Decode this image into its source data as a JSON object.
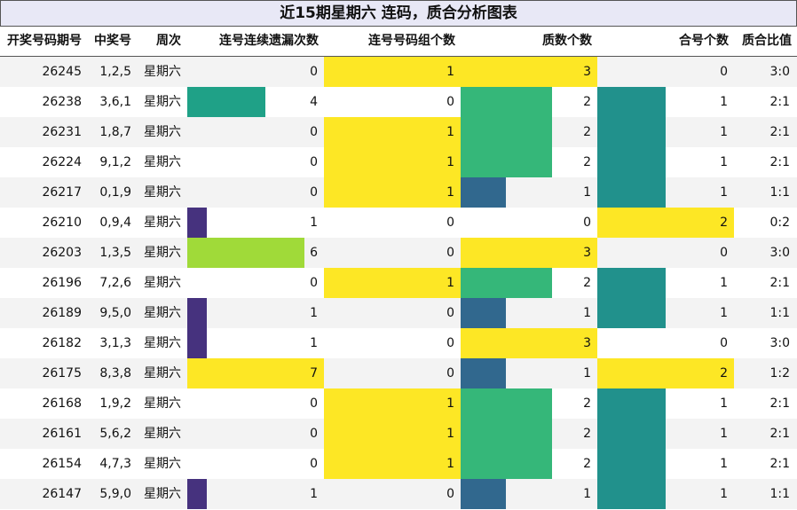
{
  "title": "近15期星期六 连码，质合分析图表",
  "headers": {
    "issue": "开奖号码期号",
    "numbers": "中奖号",
    "weekday": "周次",
    "consec_miss": "连号连续遗漏次数",
    "consec_groups": "连号号码组个数",
    "prime_count": "质数个数",
    "composite_count": "合号个数",
    "ratio": "质合比值"
  },
  "colors": {
    "v0": "#ffffff",
    "v1_purple": "#46327e",
    "v1_blue": "#31688e",
    "v2_teal": "#21918c",
    "v2_green": "#35b779",
    "v3_yellow": "#fde725",
    "v4_teal": "#1fa187",
    "v6_lime": "#a0da39",
    "v7_yellow": "#fde725"
  },
  "chart_data": {
    "type": "table",
    "columns": [
      "开奖号码期号",
      "中奖号",
      "周次",
      "连号连续遗漏次数",
      "连号号码组个数",
      "质数个数",
      "合号个数",
      "质合比值"
    ],
    "rows": [
      {
        "issue": "26245",
        "numbers": "1,2,5",
        "weekday": "星期六",
        "consec_miss": 0,
        "consec_groups": 1,
        "prime_count": 3,
        "composite_count": 0,
        "ratio": "3:0"
      },
      {
        "issue": "26238",
        "numbers": "3,6,1",
        "weekday": "星期六",
        "consec_miss": 4,
        "consec_groups": 0,
        "prime_count": 2,
        "composite_count": 1,
        "ratio": "2:1"
      },
      {
        "issue": "26231",
        "numbers": "1,8,7",
        "weekday": "星期六",
        "consec_miss": 0,
        "consec_groups": 1,
        "prime_count": 2,
        "composite_count": 1,
        "ratio": "2:1"
      },
      {
        "issue": "26224",
        "numbers": "9,1,2",
        "weekday": "星期六",
        "consec_miss": 0,
        "consec_groups": 1,
        "prime_count": 2,
        "composite_count": 1,
        "ratio": "2:1"
      },
      {
        "issue": "26217",
        "numbers": "0,1,9",
        "weekday": "星期六",
        "consec_miss": 0,
        "consec_groups": 1,
        "prime_count": 1,
        "composite_count": 1,
        "ratio": "1:1"
      },
      {
        "issue": "26210",
        "numbers": "0,9,4",
        "weekday": "星期六",
        "consec_miss": 1,
        "consec_groups": 0,
        "prime_count": 0,
        "composite_count": 2,
        "ratio": "0:2"
      },
      {
        "issue": "26203",
        "numbers": "1,3,5",
        "weekday": "星期六",
        "consec_miss": 6,
        "consec_groups": 0,
        "prime_count": 3,
        "composite_count": 0,
        "ratio": "3:0"
      },
      {
        "issue": "26196",
        "numbers": "7,2,6",
        "weekday": "星期六",
        "consec_miss": 0,
        "consec_groups": 1,
        "prime_count": 2,
        "composite_count": 1,
        "ratio": "2:1"
      },
      {
        "issue": "26189",
        "numbers": "9,5,0",
        "weekday": "星期六",
        "consec_miss": 1,
        "consec_groups": 0,
        "prime_count": 1,
        "composite_count": 1,
        "ratio": "1:1"
      },
      {
        "issue": "26182",
        "numbers": "3,1,3",
        "weekday": "星期六",
        "consec_miss": 1,
        "consec_groups": 0,
        "prime_count": 3,
        "composite_count": 0,
        "ratio": "3:0"
      },
      {
        "issue": "26175",
        "numbers": "8,3,8",
        "weekday": "星期六",
        "consec_miss": 7,
        "consec_groups": 0,
        "prime_count": 1,
        "composite_count": 2,
        "ratio": "1:2"
      },
      {
        "issue": "26168",
        "numbers": "1,9,2",
        "weekday": "星期六",
        "consec_miss": 0,
        "consec_groups": 1,
        "prime_count": 2,
        "composite_count": 1,
        "ratio": "2:1"
      },
      {
        "issue": "26161",
        "numbers": "5,6,2",
        "weekday": "星期六",
        "consec_miss": 0,
        "consec_groups": 1,
        "prime_count": 2,
        "composite_count": 1,
        "ratio": "2:1"
      },
      {
        "issue": "26154",
        "numbers": "4,7,3",
        "weekday": "星期六",
        "consec_miss": 0,
        "consec_groups": 1,
        "prime_count": 2,
        "composite_count": 1,
        "ratio": "2:1"
      },
      {
        "issue": "26147",
        "numbers": "5,9,0",
        "weekday": "星期六",
        "consec_miss": 1,
        "consec_groups": 0,
        "prime_count": 1,
        "composite_count": 1,
        "ratio": "1:1"
      }
    ]
  }
}
